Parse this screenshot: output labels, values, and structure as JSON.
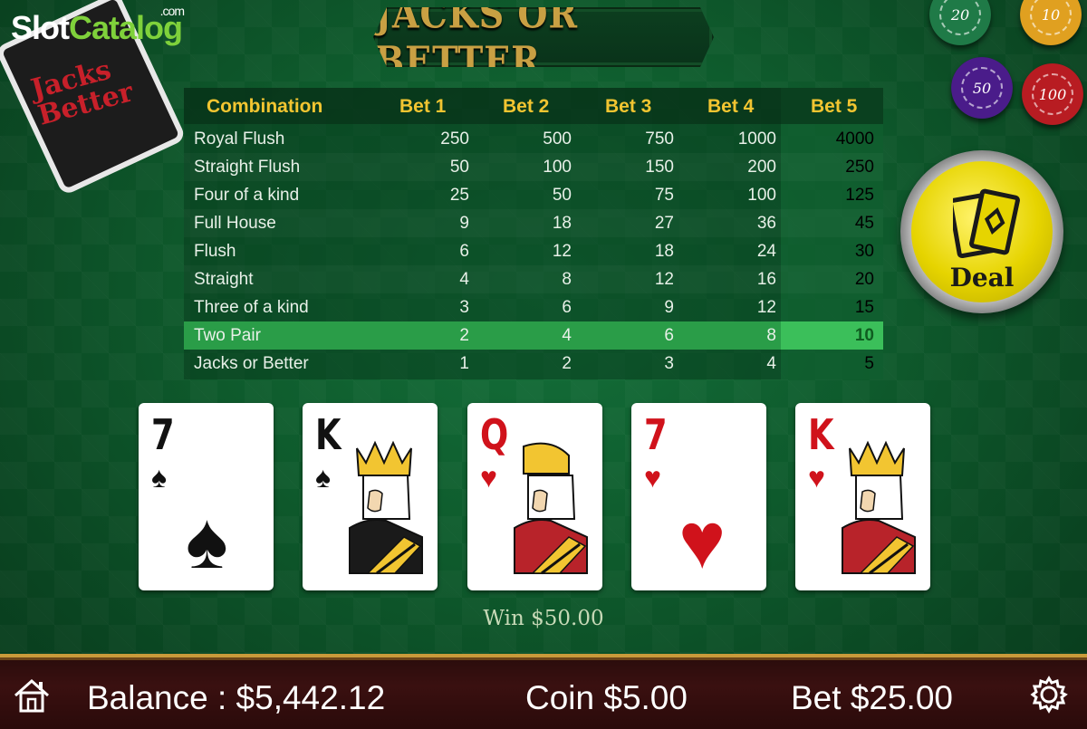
{
  "watermark": {
    "slot": "Slot",
    "catalog": "Catalog",
    "com": ".com"
  },
  "deck_card": {
    "text": "Jacks Better"
  },
  "title": "JACKS OR BETTER",
  "chips": [
    {
      "value": "20",
      "color": "#1f7a47"
    },
    {
      "value": "10",
      "color": "#e0a020"
    },
    {
      "value": "50",
      "color": "#4a1c8a"
    },
    {
      "value": "100",
      "color": "#b81c22"
    }
  ],
  "deal_button": {
    "label": "Deal"
  },
  "paytable": {
    "headers": [
      "Combination",
      "Bet 1",
      "Bet 2",
      "Bet 3",
      "Bet 4",
      "Bet 5"
    ],
    "rows": [
      {
        "name": "Royal Flush",
        "values": [
          "250",
          "500",
          "750",
          "1000",
          "4000"
        ]
      },
      {
        "name": "Straight Flush",
        "values": [
          "50",
          "100",
          "150",
          "200",
          "250"
        ]
      },
      {
        "name": "Four of a kind",
        "values": [
          "25",
          "50",
          "75",
          "100",
          "125"
        ]
      },
      {
        "name": "Full House",
        "values": [
          "9",
          "18",
          "27",
          "36",
          "45"
        ]
      },
      {
        "name": "Flush",
        "values": [
          "6",
          "12",
          "18",
          "24",
          "30"
        ]
      },
      {
        "name": "Straight",
        "values": [
          "4",
          "8",
          "12",
          "16",
          "20"
        ]
      },
      {
        "name": "Three of a kind",
        "values": [
          "3",
          "6",
          "9",
          "12",
          "15"
        ]
      },
      {
        "name": "Two Pair",
        "values": [
          "2",
          "4",
          "6",
          "8",
          "10"
        ]
      },
      {
        "name": "Jacks or Better",
        "values": [
          "1",
          "2",
          "3",
          "4",
          "5"
        ]
      }
    ],
    "highlighted_row": "Two Pair",
    "selected_bet": "Bet 5"
  },
  "cards": [
    {
      "rank": "7",
      "suit": "♠",
      "color": "black",
      "face": false
    },
    {
      "rank": "K",
      "suit": "♠",
      "color": "black",
      "face": true
    },
    {
      "rank": "Q",
      "suit": "♥",
      "color": "red",
      "face": true
    },
    {
      "rank": "7",
      "suit": "♥",
      "color": "red",
      "face": false
    },
    {
      "rank": "K",
      "suit": "♥",
      "color": "red",
      "face": true
    }
  ],
  "win": "Win $50.00",
  "bottom_bar": {
    "balance": "Balance : $5,442.12",
    "coin": "Coin $5.00",
    "bet": "Bet $25.00"
  },
  "icons": {
    "home": "home-icon",
    "settings": "gear-icon"
  }
}
